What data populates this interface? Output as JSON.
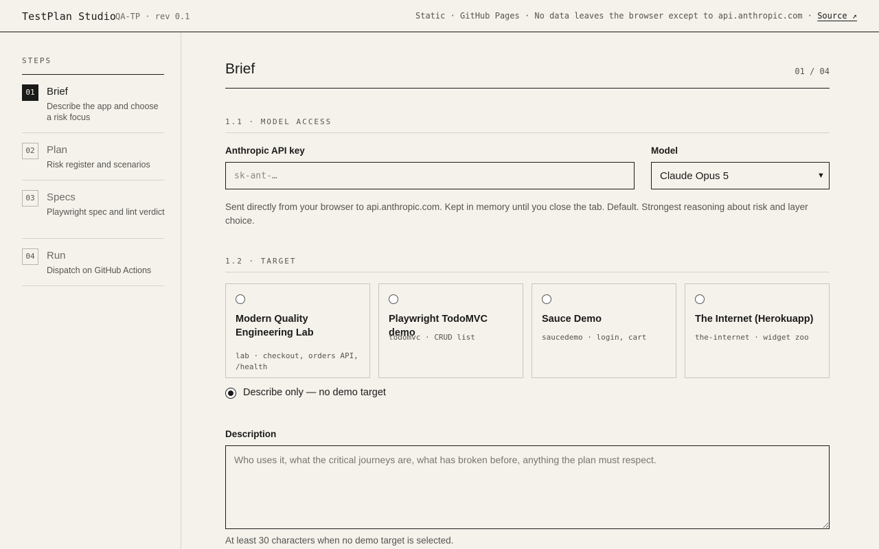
{
  "header": {
    "app_title": "TestPlan Studio",
    "revision": "QA-TP · rev 0.1",
    "notice": "Static · GitHub Pages · No data leaves the browser except to api.anthropic.com · ",
    "source_link": "Source ↗"
  },
  "sidebar": {
    "heading": "STEPS",
    "steps": [
      {
        "num": "01",
        "title": "Brief",
        "desc": "Describe the app and choose a risk focus",
        "active": true
      },
      {
        "num": "02",
        "title": "Plan",
        "desc": "Risk register and scenarios",
        "active": false
      },
      {
        "num": "03",
        "title": "Specs",
        "desc": "Playwright spec and lint verdict",
        "active": false
      },
      {
        "num": "04",
        "title": "Run",
        "desc": "Dispatch on GitHub Actions",
        "active": false
      }
    ]
  },
  "main": {
    "title": "Brief",
    "step_counter": "01 / 04",
    "model_access": {
      "section": "1.1 · MODEL ACCESS",
      "api_key_label": "Anthropic API key",
      "api_key_placeholder": "sk-ant-…",
      "api_key_value": "",
      "model_label": "Model",
      "model_selected": "Claude Opus 5",
      "helper": "Sent directly from your browser to api.anthropic.com. Kept in memory until you close the tab. Default. Strongest reasoning about risk and layer choice."
    },
    "target": {
      "section": "1.2 · TARGET",
      "options": [
        {
          "title": "Modern Quality Engineering Lab",
          "sub": "lab · checkout, orders API, /health",
          "selected": false
        },
        {
          "title": "Playwright TodoMVC demo",
          "sub": "todomvc · CRUD list",
          "selected": false
        },
        {
          "title": "Sauce Demo",
          "sub": "saucedemo · login, cart",
          "selected": false
        },
        {
          "title": "The Internet (Herokuapp)",
          "sub": "the-internet · widget zoo",
          "selected": false
        }
      ],
      "describe_only_label": "Describe only — no demo target",
      "describe_only_selected": true
    },
    "description": {
      "label": "Description",
      "placeholder": "Who uses it, what the critical journeys are, what has broken before, anything the plan must respect.",
      "value": "",
      "helper": "At least 30 characters when no demo target is selected."
    }
  }
}
